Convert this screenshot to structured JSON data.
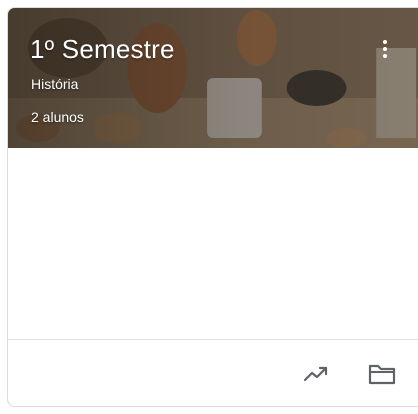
{
  "card": {
    "title": "1º Semestre",
    "subject": "História",
    "students": "2 alunos"
  },
  "header": {
    "image": "prehistoric-scene-illustration"
  },
  "icons": {
    "more": "more-vert-icon",
    "trending": "trending-up-icon",
    "folder": "folder-icon"
  },
  "colors": {
    "header_text": "#ffffff",
    "icon": "#5f6368",
    "border": "#dadce0"
  }
}
